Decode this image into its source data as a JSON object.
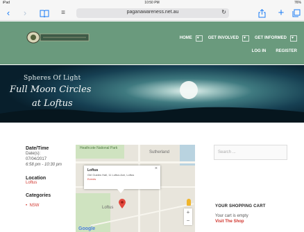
{
  "status_bar": {
    "device": "iPad",
    "time": "10:50 PM",
    "battery": "76%"
  },
  "browser": {
    "url": "paganawareness.net.au"
  },
  "nav": {
    "home": "HOME",
    "get_involved": "GET INVOLVED",
    "get_informed": "GET INFORMED",
    "login": "LOG IN",
    "register": "REGISTER"
  },
  "hero": {
    "subtitle": "Spheres Of Light",
    "title_line1": "Full Moon Circles",
    "title_line2": "at Loftus"
  },
  "event": {
    "datetime_label": "Date/Time",
    "dates_label": "Date(s):",
    "date": "07/04/2017",
    "time": "6:58 pm - 10:30 pm",
    "location_label": "Location",
    "location": "Loftus",
    "categories_label": "Categories",
    "category": "NSW"
  },
  "map": {
    "popup_title": "Loftus",
    "popup_address": "Girl Guides Hall, 11 Loftus Ave, Loftus",
    "popup_event": "Events",
    "label_top": "Heathcote National Park",
    "label_suburb": "Sutherland",
    "label_loftus": "Loftus",
    "google": "Google",
    "zoom_in": "+",
    "zoom_out": "−"
  },
  "sidebar": {
    "search_placeholder": "Search ...",
    "cart_title": "YOUR SHOPPING CART",
    "cart_empty": "Your cart is empty",
    "cart_link": "Visit The Shop"
  }
}
